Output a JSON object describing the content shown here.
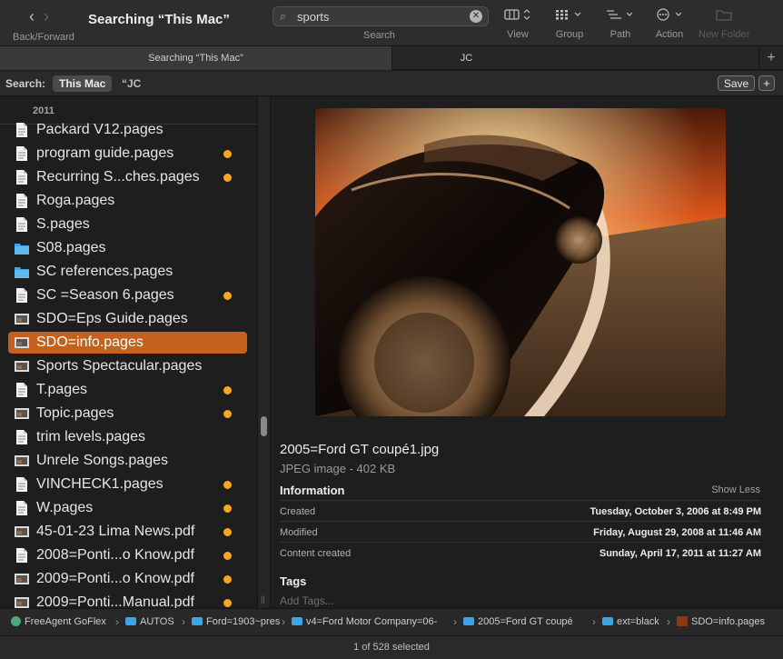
{
  "toolbar": {
    "back_forward_label": "Back/Forward",
    "window_title": "Searching “This Mac”",
    "search_value": "sports",
    "search_label": "Search",
    "view_label": "View",
    "group_label": "Group",
    "path_label": "Path",
    "action_label": "Action",
    "new_folder_label": "New Folder"
  },
  "tabs": [
    {
      "label": "Searching “This Mac”"
    },
    {
      "label": "JC"
    }
  ],
  "scope": {
    "label": "Search:",
    "selected": "This Mac",
    "other": "“JC",
    "save_label": "Save",
    "add_label": "+"
  },
  "list": {
    "group_header": "2011",
    "items": [
      {
        "name": "Packard V12.pages",
        "icon": "document-icon",
        "tag": false
      },
      {
        "name": "program guide.pages",
        "icon": "document-icon",
        "tag": true
      },
      {
        "name": "Recurring S...ches.pages",
        "icon": "document-icon",
        "tag": true
      },
      {
        "name": "Roga.pages",
        "icon": "document-icon",
        "tag": false
      },
      {
        "name": "S.pages",
        "icon": "document-icon",
        "tag": false
      },
      {
        "name": "S08.pages",
        "icon": "folder-icon",
        "tag": false
      },
      {
        "name": "SC references.pages",
        "icon": "folder-icon",
        "tag": false
      },
      {
        "name": "SC =Season 6.pages",
        "icon": "document-icon",
        "tag": true
      },
      {
        "name": "SDO=Eps Guide.pages",
        "icon": "thumbnail-icon",
        "tag": false
      },
      {
        "name": "SDO=info.pages",
        "icon": "thumbnail-icon",
        "tag": false,
        "selected": true
      },
      {
        "name": "Sports Spectacular.pages",
        "icon": "thumbnail-icon",
        "tag": false
      },
      {
        "name": "T.pages",
        "icon": "document-icon",
        "tag": true
      },
      {
        "name": "Topic.pages",
        "icon": "thumbnail-icon",
        "tag": true
      },
      {
        "name": "trim levels.pages",
        "icon": "document-icon",
        "tag": false
      },
      {
        "name": "Unrele Songs.pages",
        "icon": "thumbnail-icon",
        "tag": false
      },
      {
        "name": "VINCHECK1.pages",
        "icon": "document-icon",
        "tag": true
      },
      {
        "name": "W.pages",
        "icon": "document-icon",
        "tag": true
      },
      {
        "name": "45-01-23 Lima News.pdf",
        "icon": "thumbnail-icon",
        "tag": true
      },
      {
        "name": "2008=Ponti...o Know.pdf",
        "icon": "document-icon",
        "tag": true
      },
      {
        "name": "2009=Ponti...o Know.pdf",
        "icon": "thumbnail-icon",
        "tag": true
      },
      {
        "name": "2009=Ponti...Manual.pdf",
        "icon": "thumbnail-icon",
        "tag": true
      }
    ]
  },
  "preview": {
    "file_name": "2005=Ford GT coupé1.jpg",
    "kind": "JPEG image - 402 KB",
    "information_label": "Information",
    "show_less": "Show Less",
    "rows": [
      {
        "key": "Created",
        "value": "Tuesday, October 3, 2006 at 8:49 PM"
      },
      {
        "key": "Modified",
        "value": "Friday, August 29, 2008 at 11:46 AM"
      },
      {
        "key": "Content created",
        "value": "Sunday, April 17, 2011 at 11:27 AM"
      }
    ],
    "tags_label": "Tags",
    "tags_placeholder": "Add Tags..."
  },
  "path": {
    "crumbs": [
      {
        "label": "FreeAgent GoFlex",
        "kind": "drive"
      },
      {
        "label": "AUTOS",
        "kind": "folder"
      },
      {
        "label": "Ford=1903~pres",
        "kind": "folder"
      },
      {
        "label": "v4=Ford Motor Company=06-",
        "kind": "folder"
      },
      {
        "label": "2005=Ford GT coupé",
        "kind": "folder"
      },
      {
        "label": "ext=black",
        "kind": "folder"
      },
      {
        "label": "SDO=info.pages",
        "kind": "file"
      }
    ]
  },
  "status": {
    "text": "1 of 528 selected"
  },
  "colors": {
    "selection": "#c5601d",
    "tag_orange": "#f5a623",
    "folder_blue": "#3da5e6"
  }
}
